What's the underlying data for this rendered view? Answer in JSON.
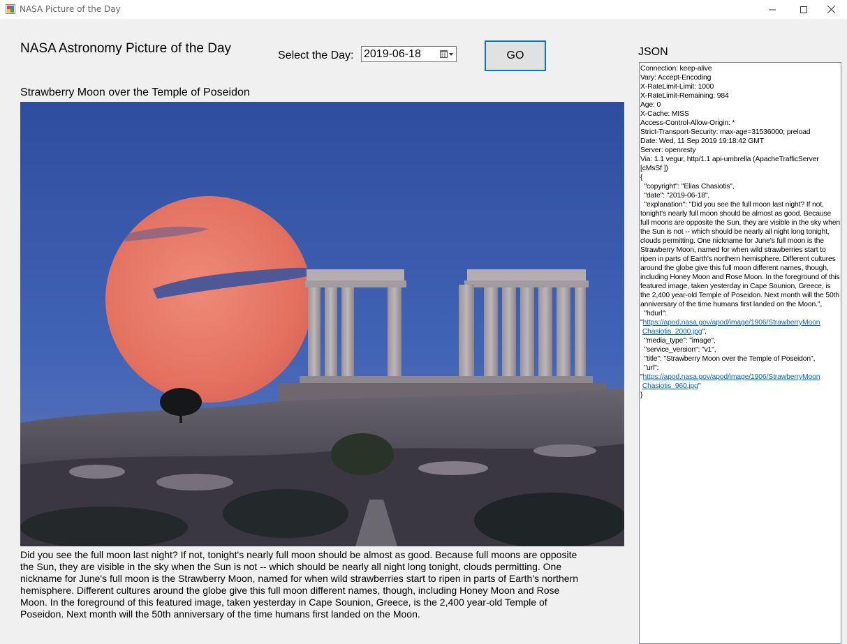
{
  "window": {
    "title": "NASA Picture of the Day"
  },
  "header": {
    "heading": "NASA Astronomy Picture of the Day",
    "date_label": "Select the Day:",
    "date_value": "2019-06-18",
    "go_label": "GO"
  },
  "picture": {
    "title": "Strawberry Moon over the Temple of Poseidon",
    "explanation": "Did you see the full moon last night? If not, tonight's nearly full moon should be almost as good. Because full moons are opposite the Sun, they are visible in the sky when the Sun is not -- which should be nearly all night long tonight, clouds permitting. One nickname for June's full moon is the Strawberry Moon, named for when wild strawberries start to ripen in parts of Earth's northern hemisphere. Different cultures around the globe give this full moon different names, though, including Honey Moon and Rose Moon.  In the foreground of this featured image, taken yesterday in Cape Sounion, Greece, is the 2,400 year-old Temple of Poseidon.  Next month will the 50th anniversary of the time humans first landed on the Moon."
  },
  "json_panel": {
    "label": "JSON",
    "headers": [
      "Connection: keep-alive",
      "Vary: Accept-Encoding",
      "X-RateLimit-Limit: 1000",
      "X-RateLimit-Remaining: 984",
      "Age: 0",
      "X-Cache: MISS",
      "Access-Control-Allow-Origin: *",
      "Strict-Transport-Security: max-age=31536000; preload",
      "Date: Wed, 11 Sep 2019 19:18:42 GMT",
      "Server: openresty"
    ],
    "via": "Via: 1.1 vegur, http/1.1 api-umbrella (ApacheTrafficServer [cMsSf ])",
    "open_brace": "{",
    "copyright": "  \"copyright\": \"Elias Chasiotis\",",
    "date": "  \"date\": \"2019-06-18\",",
    "explanation": "  \"explanation\": \"Did you see the full moon last night? If not, tonight's nearly full moon should be almost as good. Because full moons are opposite the Sun, they are visible in the sky when the Sun is not -- which should be nearly all night long tonight, clouds permitting. One nickname for June's full moon is the Strawberry Moon, named for when wild strawberries start to ripen in parts of Earth's northern hemisphere. Different cultures around the globe give this full moon different names, though, including Honey Moon and Rose Moon.  In the foreground of this featured image, taken yesterday in Cape Sounion, Greece, is the 2,400 year-old Temple of Poseidon.  Next month will the 50th anniversary of the time humans first landed on the Moon.\",",
    "hdurl_key": "  \"hdurl\":",
    "hdurl_quote_open": "\"",
    "hdurl_link_line1": "https://apod.nasa.gov/apod/image/1906/StrawberryMoon",
    "hdurl_link_line2": "Chasiotis_2000.jpg",
    "hdurl_quote_close": "\",",
    "media_type": "  \"media_type\": \"image\",",
    "service_version": "  \"service_version\": \"v1\",",
    "title": "  \"title\": \"Strawberry Moon over the Temple of Poseidon\",",
    "url_key": "  \"url\":",
    "url_quote_open": "\"",
    "url_link_line1": "https://apod.nasa.gov/apod/image/1906/StrawberryMoon",
    "url_link_line2": "Chasiotis_960.jpg",
    "url_quote_close": "\"",
    "close_brace": "}"
  },
  "colors": {
    "sky": "#3b5aa8",
    "moon": "#e8796b",
    "focus_border": "#0078d7",
    "link": "#0066cc"
  }
}
